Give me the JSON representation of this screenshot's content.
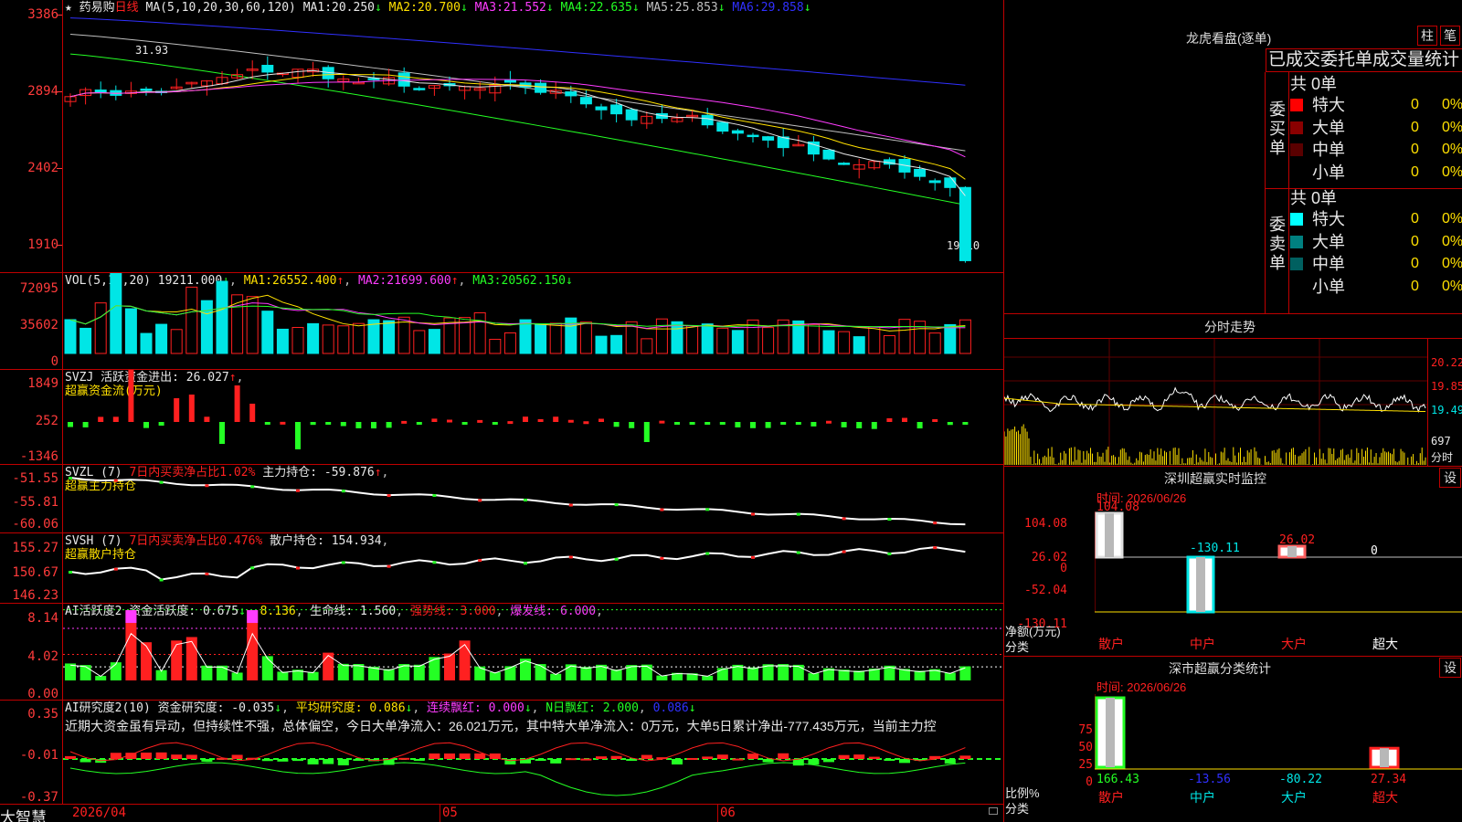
{
  "colors": {
    "up": "#ff2020",
    "down": "#24ff24",
    "down_candle": "#00e6e6",
    "grid": "#c00000",
    "axis": "#ff3b3b",
    "ma1": "#e8e8e8",
    "ma2": "#ffe000",
    "ma3": "#ff3cff",
    "ma4": "#24ff24",
    "ma5": "#c0c0c0",
    "ma6": "#3030ff"
  },
  "price_panel": {
    "star": "★",
    "stock_name": "药易购",
    "period": "日线",
    "ma_params": "MA(5,10,20,30,60,120)",
    "ma1": {
      "label": "MA1:",
      "value": "20.250",
      "arrow": "↓"
    },
    "ma2": {
      "label": "MA2:",
      "value": "20.700",
      "arrow": "↓"
    },
    "ma3": {
      "label": "MA3:",
      "value": "21.552",
      "arrow": "↓"
    },
    "ma4": {
      "label": "MA4:",
      "value": "22.635",
      "arrow": "↓"
    },
    "ma5": {
      "label": "MA5:",
      "value": "25.853",
      "arrow": "↓"
    },
    "ma6": {
      "label": "MA6:",
      "value": "29.858",
      "arrow": "↓"
    },
    "axis": [
      "3386",
      "2894",
      "2402",
      "1910"
    ],
    "high_label": "31.93",
    "low_label": "19.10"
  },
  "vol_panel": {
    "params": "VOL(5,10,20)",
    "value": "19211.000",
    "ma1": {
      "label": "MA1:",
      "value": "26552.400",
      "arrow": "↑"
    },
    "ma2": {
      "label": "MA2:",
      "value": "21699.600",
      "arrow": "↑"
    },
    "ma3": {
      "label": "MA3:",
      "value": "20562.150",
      "arrow": "↓"
    },
    "axis": [
      "72095",
      "35602",
      "0"
    ]
  },
  "svzj_panel": {
    "name": "SVZJ",
    "label": "活跃资金进出:",
    "value": "26.027",
    "arrow": "↑",
    "subtitle": "超赢资金流(万元)",
    "axis": [
      "1849",
      "252",
      "-1346"
    ]
  },
  "svzl_panel": {
    "name": "SVZL (7)",
    "label1": "7日内买卖净占比",
    "value1": "1.02%",
    "label2": "主力持仓:",
    "value2": "-59.876",
    "arrow": "↑",
    "subtitle": "超赢主力持仓",
    "axis": [
      "-51.55",
      "-55.81",
      "-60.06"
    ]
  },
  "svsh_panel": {
    "name": "SVSH (7)",
    "label1": "7日内买卖净占比",
    "value1": "0.476%",
    "label2": "散户持仓:",
    "value2": "154.934",
    "subtitle": "超赢散户持仓",
    "axis": [
      "155.27",
      "150.67",
      "146.23"
    ]
  },
  "ai_active_panel": {
    "name": "AI活跃度2",
    "label1": "资金活跃度:",
    "value1": "0.675",
    "value1b": "8.136",
    "label2": "生命线:",
    "value2": "1.560",
    "label3": "强势线:",
    "value3": "3.000",
    "label4": "爆发线:",
    "value4": "6.000",
    "axis": [
      "8.14",
      "4.02",
      "0.00"
    ]
  },
  "ai_research_panel": {
    "name": "AI研究度2(10)",
    "label1": "资金研究度:",
    "value1": "-0.035",
    "label2": "平均研究度:",
    "value2": "0.086",
    "label3": "连续飘红:",
    "value3": "0.000",
    "label4": "N日飘红:",
    "value4": "2.000",
    "value5": "0.086",
    "commentary": "近期大资金虽有异动，但持续性不强，总体偏空，今日大单净流入：26.021万元，其中特大单净流入：0万元，大单5日累计净出-777.435万元，当前主力控",
    "axis": [
      "0.35",
      "-0.01",
      "-0.37"
    ]
  },
  "date_axis": {
    "labels": [
      "2026/04",
      "05",
      "06"
    ]
  },
  "brand": "大智慧",
  "right": {
    "lhb_title": "龙虎看盘(逐单)",
    "btn_zhu": "柱",
    "btn_bi": "笔",
    "tab_title": "已成交委托单成交量统计",
    "buy_total": "共 0单",
    "buy_label": "委买单",
    "sell_total": "共 0单",
    "sell_label": "委卖单",
    "buy_rows": [
      {
        "name": "特大",
        "count": "0",
        "pct": "0%",
        "color": "#ff0000"
      },
      {
        "name": "大单",
        "count": "0",
        "pct": "0%",
        "color": "#8a0000"
      },
      {
        "name": "中单",
        "count": "0",
        "pct": "0%",
        "color": "#5a0000"
      },
      {
        "name": "小单",
        "count": "0",
        "pct": "0%",
        "color": "none"
      }
    ],
    "sell_rows": [
      {
        "name": "特大",
        "count": "0",
        "pct": "0%",
        "color": "#00ffff"
      },
      {
        "name": "大单",
        "count": "0",
        "pct": "0%",
        "color": "#008080"
      },
      {
        "name": "中单",
        "count": "0",
        "pct": "0%",
        "color": "#006060"
      },
      {
        "name": "小单",
        "count": "0",
        "pct": "0%",
        "color": "none"
      }
    ],
    "intraday_title": "分时走势",
    "intraday_axis": [
      "20.22",
      "19.85",
      "19.49"
    ],
    "intraday_vol": "697",
    "intraday_vol_unit": "分时",
    "sz_monitor_title": "深圳超赢实时监控",
    "settings_btn": "设",
    "monitor_time": "时间: 2026/06/26",
    "monitor_axis": [
      "104.08",
      "26.02",
      "0",
      "-52.04",
      "-130.11"
    ],
    "monitor_unit": "净额(万元)",
    "category_label": "分类",
    "categories": [
      "散户",
      "中户",
      "大户",
      "超大"
    ],
    "monitor_values": [
      104.08,
      -130.11,
      26.02,
      0
    ],
    "monitor_value_labels": [
      "104.08",
      "-130.11",
      "26.02",
      "0"
    ],
    "stat_title": "深市超赢分类统计",
    "stat_time": "时间: 2026/06/26",
    "stat_axis": [
      "75",
      "50",
      "25",
      "0"
    ],
    "stat_unit": "比例%",
    "stat_values": [
      166.43,
      -13.56,
      -80.22,
      27.34
    ],
    "stat_value_labels": [
      "166.43",
      "-13.56",
      "-80.22",
      "27.34"
    ]
  }
}
